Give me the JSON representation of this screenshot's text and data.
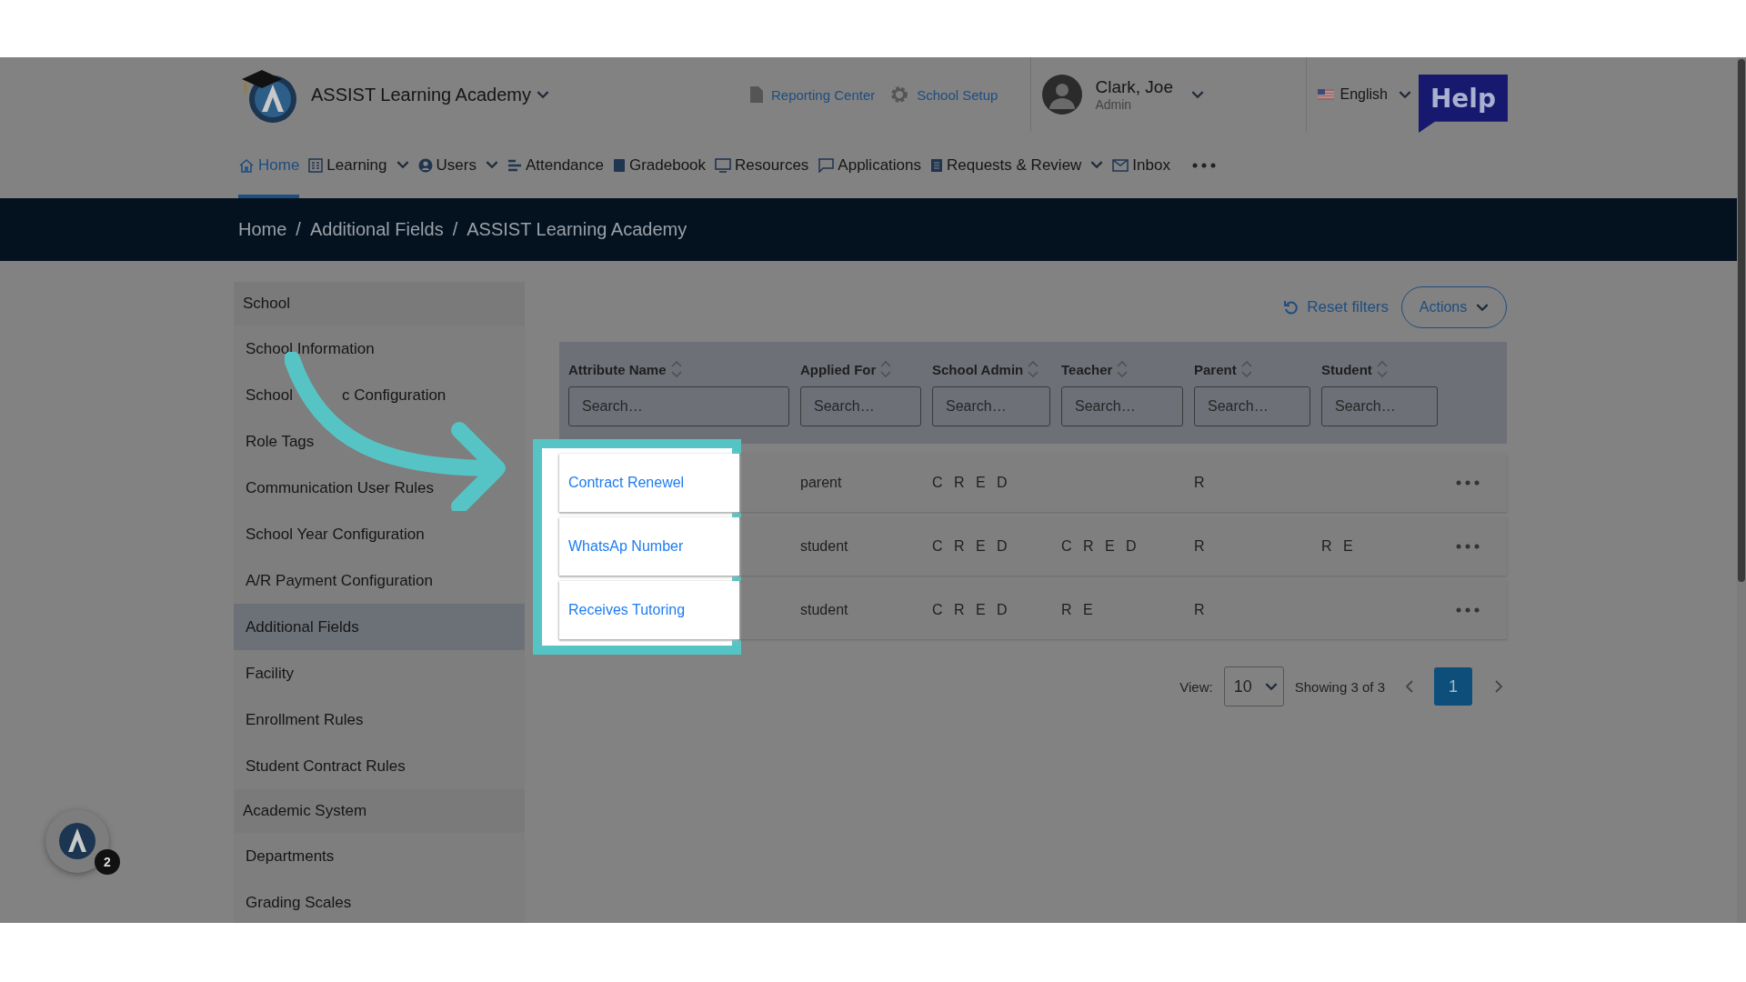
{
  "header": {
    "school_name": "ASSIST Learning Academy",
    "links": [
      {
        "kind": "report",
        "label": "Reporting Center"
      },
      {
        "kind": "setup",
        "label": "School Setup"
      }
    ],
    "user": {
      "name": "Clark, Joe",
      "role": "Admin"
    },
    "language": "English",
    "help_label": "Help"
  },
  "nav": [
    {
      "kind": "home",
      "label": "Home",
      "selected": true,
      "has_menu": false
    },
    {
      "kind": "learning",
      "label": "Learning",
      "selected": false,
      "has_menu": true
    },
    {
      "kind": "users",
      "label": "Users",
      "selected": false,
      "has_menu": true
    },
    {
      "kind": "attendance",
      "label": "Attendance",
      "selected": false,
      "has_menu": false
    },
    {
      "kind": "gradebook",
      "label": "Gradebook",
      "selected": false,
      "has_menu": false
    },
    {
      "kind": "resources",
      "label": "Resources",
      "selected": false,
      "has_menu": false
    },
    {
      "kind": "applications",
      "label": "Applications",
      "selected": false,
      "has_menu": false
    },
    {
      "kind": "requests",
      "label": "Requests & Review",
      "selected": false,
      "has_menu": true
    },
    {
      "kind": "inbox",
      "label": "Inbox",
      "selected": false,
      "has_menu": false
    }
  ],
  "breadcrumb": {
    "separator": "/",
    "items": [
      "Home",
      "Additional Fields",
      "ASSIST Learning Academy"
    ]
  },
  "sidebar": [
    {
      "title": "School",
      "items": [
        {
          "label": "School Information",
          "selected": false
        },
        {
          "label": "School",
          "label_continued": "c Configuration",
          "selected": false
        },
        {
          "label": "Role Tags",
          "selected": false
        },
        {
          "label": "Communication User Rules",
          "selected": false
        },
        {
          "label": "School Year Configuration",
          "selected": false
        },
        {
          "label": "A/R Payment Configuration",
          "selected": false
        },
        {
          "label": "Additional Fields",
          "selected": true
        },
        {
          "label": "Facility",
          "selected": false
        },
        {
          "label": "Enrollment Rules",
          "selected": false
        },
        {
          "label": "Student Contract Rules",
          "selected": false
        }
      ]
    },
    {
      "title": "Academic System",
      "items": [
        {
          "label": "Departments",
          "selected": false
        },
        {
          "label": "Grading Scales",
          "selected": false
        }
      ]
    }
  ],
  "toolbar": {
    "reset_label": "Reset filters",
    "actions_label": "Actions"
  },
  "table": {
    "columns": [
      {
        "label": "Attribute Name",
        "placeholder": "Search…"
      },
      {
        "label": "Applied For",
        "placeholder": "Search…"
      },
      {
        "label": "School Admin",
        "placeholder": "Search…"
      },
      {
        "label": "Teacher",
        "placeholder": "Search…"
      },
      {
        "label": "Parent",
        "placeholder": "Search…"
      },
      {
        "label": "Student",
        "placeholder": "Search…"
      }
    ],
    "rows": [
      {
        "cells": [
          "Contract Renewel",
          "parent",
          "C R E D",
          null,
          "R",
          null
        ]
      },
      {
        "cells": [
          "WhatsAp Number",
          "student",
          "C R E D",
          "C R E D",
          "R",
          "R E"
        ]
      },
      {
        "cells": [
          "Receives Tutoring",
          "student",
          "C R E D",
          "R E",
          "R",
          null
        ]
      }
    ]
  },
  "pagination": {
    "view_label": "View:",
    "page_size": "10",
    "showing": "Showing 3 of 3",
    "pages": [
      {
        "label": "1",
        "selected": true
      }
    ]
  },
  "chat": {
    "badge": "2"
  }
}
